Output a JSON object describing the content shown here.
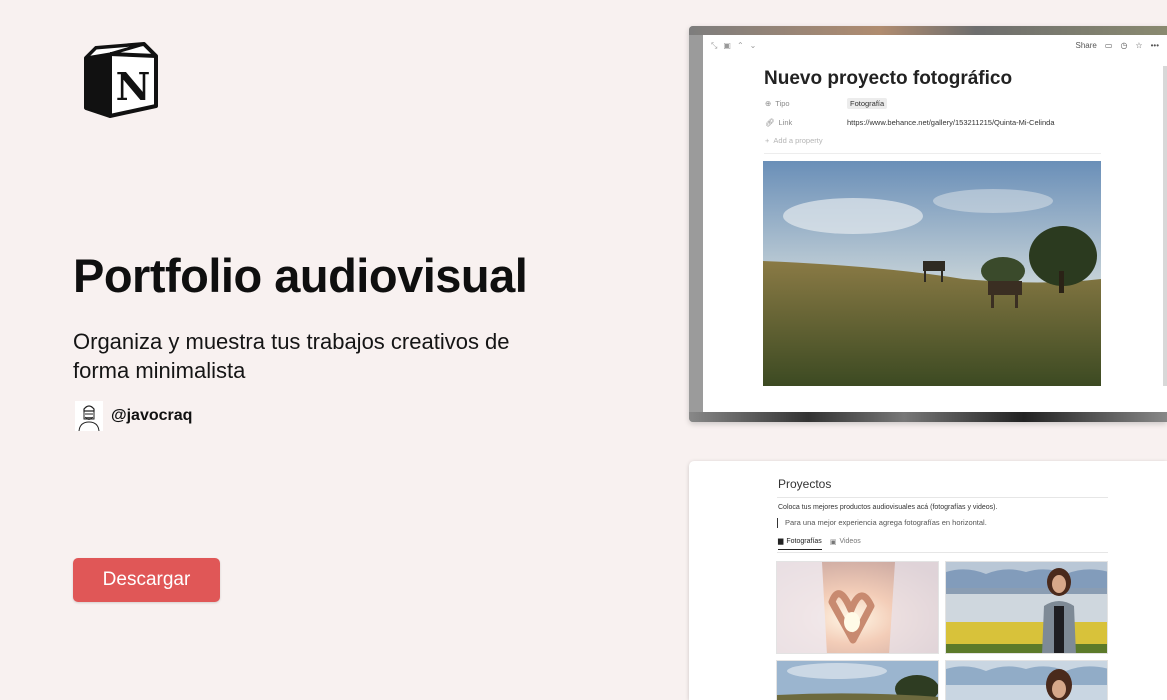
{
  "hero": {
    "title": "Portfolio audiovisual",
    "subtitle": "Organiza y muestra tus trabajos creativos de forma minimalista",
    "author_handle": "@javocraq",
    "download_label": "Descargar"
  },
  "colors": {
    "background": "#f8f1f0",
    "accent": "#e05757"
  },
  "window_project": {
    "toolbar_share": "Share",
    "page_title": "Nuevo proyecto fotográfico",
    "properties": [
      {
        "name": "Tipo",
        "value": "Fotografía",
        "icon": "circle-plus-icon"
      },
      {
        "name": "Link",
        "value": "https://www.behance.net/gallery/153211215/Quinta-Mi-Celinda",
        "icon": "link-icon"
      }
    ],
    "add_property_label": "Add a property"
  },
  "window_gallery": {
    "title": "Proyectos",
    "description": "Coloca tus mejores productos audiovisuales acá (fotografías y videos).",
    "quote": "Para una mejor experiencia agrega fotografías en horizontal.",
    "tabs": [
      {
        "label": "Fotografías",
        "active": true,
        "icon": "gallery-icon"
      },
      {
        "label": "Videos",
        "active": false,
        "icon": "camera-icon"
      }
    ]
  }
}
